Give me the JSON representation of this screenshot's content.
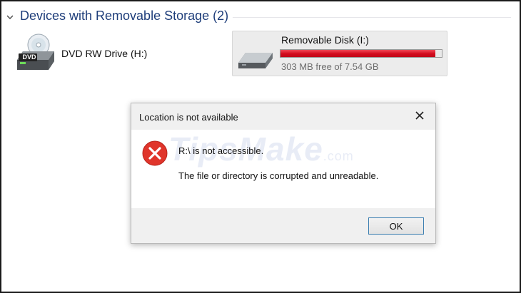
{
  "group": {
    "title": "Devices with Removable Storage (2)",
    "collapse_icon": "chevron-down-icon"
  },
  "dvd_drive": {
    "label": "DVD RW Drive (H:)",
    "icon": "dvd-drive-icon",
    "icon_text": "DVD"
  },
  "removable_disk": {
    "name": "Removable Disk (I:)",
    "free_text": "303 MB free of 7.54 GB",
    "used_fraction": 0.96,
    "bar_color": "#d30b1d",
    "icon": "usb-drive-icon"
  },
  "dialog": {
    "title": "Location is not available",
    "message_line1": "R:\\ is not accessible.",
    "message_line2": "The file or directory is corrupted and unreadable.",
    "ok_label": "OK",
    "error_icon": "error-icon",
    "error_color": "#e0352b",
    "close_icon": "close-icon"
  },
  "watermark": {
    "text": "TipsMake",
    "suffix": ".com"
  }
}
